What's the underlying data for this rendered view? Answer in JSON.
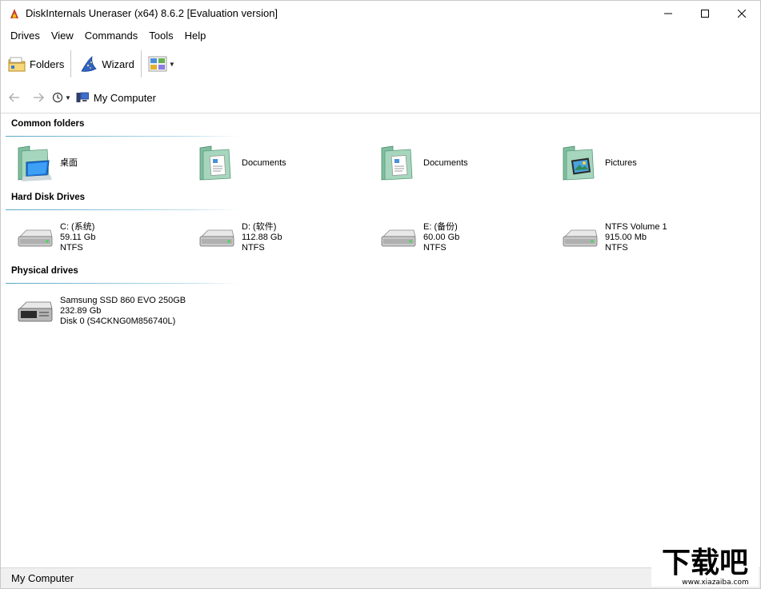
{
  "window": {
    "title": "DiskInternals Uneraser (x64) 8.6.2 [Evaluation version]"
  },
  "menu": {
    "items": [
      "Drives",
      "View",
      "Commands",
      "Tools",
      "Help"
    ]
  },
  "toolbar": {
    "folders_label": "Folders",
    "wizard_label": "Wizard"
  },
  "address": {
    "crumb": "My Computer"
  },
  "sections": {
    "common_folders": {
      "title": "Common folders",
      "items": [
        {
          "name": "桌面",
          "icon": "desktop-folder-icon"
        },
        {
          "name": "Documents",
          "icon": "documents-folder-icon"
        },
        {
          "name": "Documents",
          "icon": "documents-folder-icon"
        },
        {
          "name": "Pictures",
          "icon": "pictures-folder-icon"
        }
      ]
    },
    "hard_disk_drives": {
      "title": "Hard Disk Drives",
      "items": [
        {
          "name": "C: (系统)",
          "size": "59.11 Gb",
          "fs": "NTFS"
        },
        {
          "name": "D: (软件)",
          "size": "112.88 Gb",
          "fs": "NTFS"
        },
        {
          "name": "E: (备份)",
          "size": "60.00 Gb",
          "fs": "NTFS"
        },
        {
          "name": "NTFS Volume 1",
          "size": "915.00 Mb",
          "fs": "NTFS"
        }
      ]
    },
    "physical_drives": {
      "title": "Physical drives",
      "items": [
        {
          "name": "Samsung SSD 860 EVO 250GB",
          "size": "232.89 Gb",
          "detail": "Disk 0 (S4CKNG0M856740L)"
        }
      ]
    }
  },
  "status": {
    "text": "My Computer"
  },
  "watermark": {
    "brand": "下载吧",
    "url": "www.xiazaiba.com"
  },
  "colors": {
    "section_line": "#5aa6c8",
    "status_bg": "#f0f0f0"
  }
}
